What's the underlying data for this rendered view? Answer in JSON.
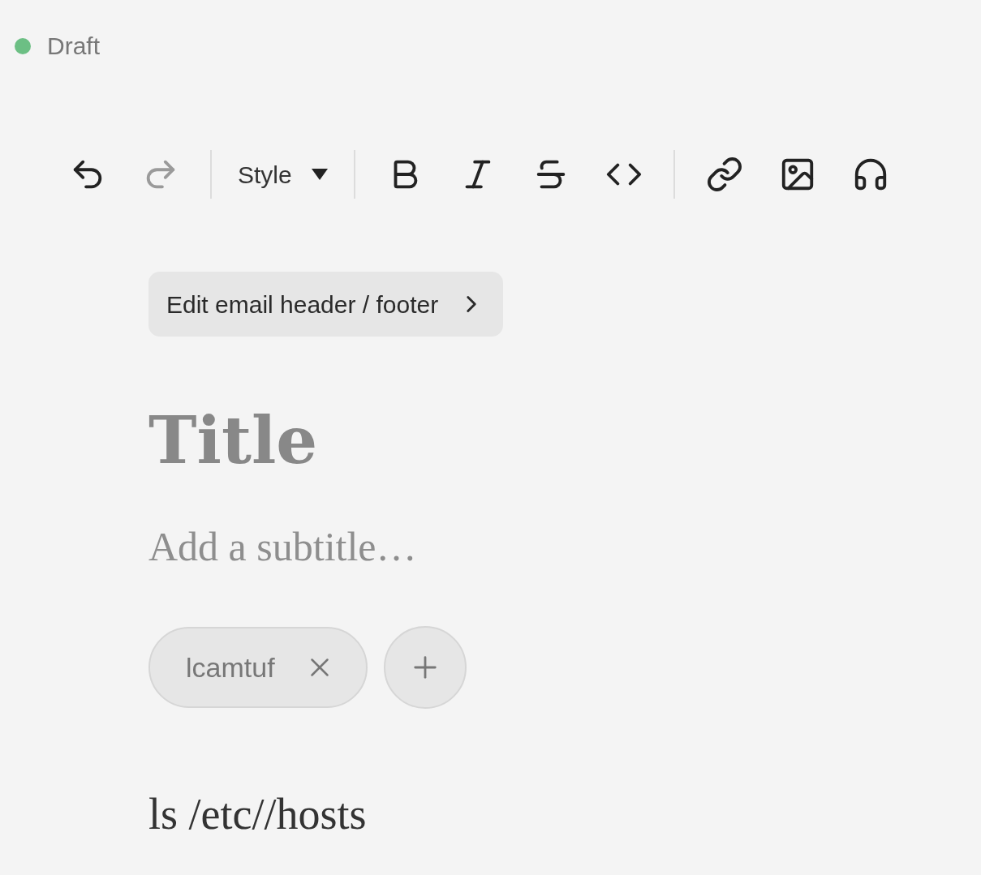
{
  "status": {
    "label": "Draft",
    "color": "#6cbf84"
  },
  "toolbar": [
    {
      "kind": "undo",
      "disabled": false
    },
    {
      "kind": "redo",
      "disabled": true
    },
    {
      "kind": "divider"
    },
    {
      "kind": "dropdown",
      "label": "Style"
    },
    {
      "kind": "divider"
    },
    {
      "kind": "bold",
      "disabled": false
    },
    {
      "kind": "italic",
      "disabled": false
    },
    {
      "kind": "strikethrough",
      "disabled": false
    },
    {
      "kind": "code",
      "disabled": false
    },
    {
      "kind": "divider"
    },
    {
      "kind": "link",
      "disabled": false
    },
    {
      "kind": "image",
      "disabled": false
    },
    {
      "kind": "audio",
      "disabled": false
    }
  ],
  "header_button": {
    "label": "Edit email header / footer"
  },
  "title": {
    "placeholder": "Title"
  },
  "subtitle": {
    "placeholder": "Add a subtitle…"
  },
  "authors": [
    {
      "name": "lcamtuf"
    }
  ],
  "body": {
    "text": "ls /etc//hosts"
  }
}
